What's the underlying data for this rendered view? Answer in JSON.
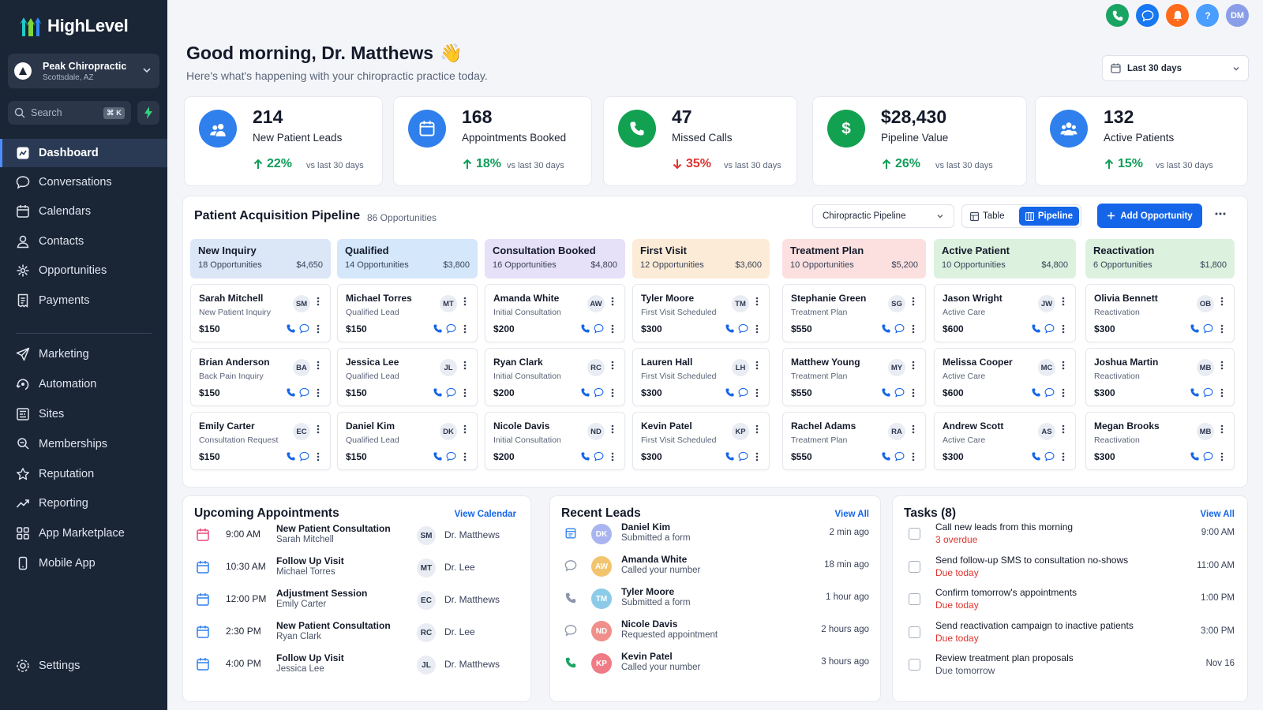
{
  "app": {
    "brand": "HighLevel"
  },
  "location": {
    "name": "Peak Chiropractic",
    "city": "Scottsdale, AZ"
  },
  "search": {
    "placeholder": "Search",
    "shortcut": "⌘ K"
  },
  "nav": [
    {
      "label": "Dashboard",
      "icon": "dashboard-icon",
      "active": true
    },
    {
      "label": "Conversations",
      "icon": "chat-icon"
    },
    {
      "label": "Calendars",
      "icon": "calendar-icon"
    },
    {
      "label": "Contacts",
      "icon": "person-icon"
    },
    {
      "label": "Opportunities",
      "icon": "opportunities-icon"
    },
    {
      "label": "Payments",
      "icon": "receipt-icon"
    },
    {
      "label": "Marketing",
      "icon": "send-icon"
    },
    {
      "label": "Automation",
      "icon": "automation-icon"
    },
    {
      "label": "Sites",
      "icon": "sites-icon"
    },
    {
      "label": "Memberships",
      "icon": "membership-icon"
    },
    {
      "label": "Reputation",
      "icon": "star-icon"
    },
    {
      "label": "Reporting",
      "icon": "trend-icon"
    },
    {
      "label": "App Marketplace",
      "icon": "grid-icon"
    },
    {
      "label": "Mobile App",
      "icon": "mobile-icon"
    }
  ],
  "settings": {
    "label": "Settings"
  },
  "top_icons": [
    {
      "name": "phone-icon",
      "color": "#19a463"
    },
    {
      "name": "chat-icon",
      "color": "#1877f2"
    },
    {
      "name": "bell-icon",
      "color": "#ff6b1a"
    },
    {
      "name": "help-icon",
      "color": "#4a9eff"
    }
  ],
  "user": {
    "initials": "DM"
  },
  "greeting": {
    "title": "Good morning, Dr. Matthews",
    "emoji": "👋",
    "subtitle": "Here's what's happening with your chiropractic practice today."
  },
  "date_range": {
    "label": "Last 30 days"
  },
  "stats": [
    {
      "value": "214",
      "label": "New Patient Leads",
      "change": "22%",
      "direction": "up",
      "compare": "vs last 30 days",
      "icon": "users-icon",
      "color": "#2f80ed"
    },
    {
      "value": "168",
      "label": "Appointments Booked",
      "change": "18%",
      "direction": "up",
      "compare": "vs last 30 days",
      "icon": "calendar-icon",
      "color": "#2f80ed"
    },
    {
      "value": "47",
      "label": "Missed Calls",
      "change": "35%",
      "direction": "down",
      "compare": "vs last 30 days",
      "icon": "phone-icon",
      "color": "#12a150"
    },
    {
      "value": "$28,430",
      "label": "Pipeline Value",
      "change": "26%",
      "direction": "up",
      "compare": "vs last 30 days",
      "icon": "dollar-icon",
      "color": "#12a150"
    },
    {
      "value": "132",
      "label": "Active Patients",
      "change": "15%",
      "direction": "up",
      "compare": "vs last 30 days",
      "icon": "group-icon",
      "color": "#2f80ed"
    }
  ],
  "pipeline": {
    "title": "Patient Acquisition Pipeline",
    "count": "86 Opportunities",
    "selector": "Chiropractic Pipeline",
    "view_table": "Table",
    "view_pipeline": "Pipeline",
    "add_button": "Add Opportunity",
    "columns": [
      {
        "name": "New Inquiry",
        "count": "18 Opportunities",
        "value": "$4,650",
        "color": "#dbe6f7",
        "cards": [
          {
            "name": "Sarah Mitchell",
            "stage": "New Patient Inquiry",
            "price": "$150",
            "initials": "SM"
          },
          {
            "name": "Brian Anderson",
            "stage": "Back Pain Inquiry",
            "price": "$150",
            "initials": "BA"
          },
          {
            "name": "Emily Carter",
            "stage": "Consultation Request",
            "price": "$150",
            "initials": "EC"
          }
        ]
      },
      {
        "name": "Qualified",
        "count": "14 Opportunities",
        "value": "$3,800",
        "color": "#d4e7fb",
        "cards": [
          {
            "name": "Michael Torres",
            "stage": "Qualified Lead",
            "price": "$150",
            "initials": "MT"
          },
          {
            "name": "Jessica Lee",
            "stage": "Qualified Lead",
            "price": "$150",
            "initials": "JL"
          },
          {
            "name": "Daniel Kim",
            "stage": "Qualified Lead",
            "price": "$150",
            "initials": "DK"
          }
        ]
      },
      {
        "name": "Consultation Booked",
        "count": "16 Opportunities",
        "value": "$4,800",
        "color": "#e6e0f8",
        "cards": [
          {
            "name": "Amanda White",
            "stage": "Initial Consultation",
            "price": "$200",
            "initials": "AW"
          },
          {
            "name": "Ryan Clark",
            "stage": "Initial Consultation",
            "price": "$200",
            "initials": "RC"
          },
          {
            "name": "Nicole Davis",
            "stage": "Initial Consultation",
            "price": "$200",
            "initials": "ND"
          }
        ]
      },
      {
        "name": "First Visit",
        "count": "12 Opportunities",
        "value": "$3,600",
        "color": "#fcebd6",
        "cards": [
          {
            "name": "Tyler Moore",
            "stage": "First Visit Scheduled",
            "price": "$300",
            "initials": "TM"
          },
          {
            "name": "Lauren Hall",
            "stage": "First Visit Scheduled",
            "price": "$300",
            "initials": "LH"
          },
          {
            "name": "Kevin Patel",
            "stage": "First Visit Scheduled",
            "price": "$300",
            "initials": "KP"
          }
        ]
      },
      {
        "name": "Treatment Plan",
        "count": "10 Opportunities",
        "value": "$5,200",
        "color": "#fbe0df",
        "cards": [
          {
            "name": "Stephanie Green",
            "stage": "Treatment Plan",
            "price": "$550",
            "initials": "SG"
          },
          {
            "name": "Matthew Young",
            "stage": "Treatment Plan",
            "price": "$550",
            "initials": "MY"
          },
          {
            "name": "Rachel Adams",
            "stage": "Treatment Plan",
            "price": "$550",
            "initials": "RA"
          }
        ]
      },
      {
        "name": "Active Patient",
        "count": "10 Opportunities",
        "value": "$4,800",
        "color": "#dcf1de",
        "cards": [
          {
            "name": "Jason Wright",
            "stage": "Active Care",
            "price": "$600",
            "initials": "JW"
          },
          {
            "name": "Melissa Cooper",
            "stage": "Active Care",
            "price": "$600",
            "initials": "MC"
          },
          {
            "name": "Andrew Scott",
            "stage": "Active Care",
            "price": "$300",
            "initials": "AS"
          }
        ]
      },
      {
        "name": "Reactivation",
        "count": "6 Opportunities",
        "value": "$1,800",
        "color": "#dcf1de",
        "cards": [
          {
            "name": "Olivia Bennett",
            "stage": "Reactivation",
            "price": "$300",
            "initials": "OB"
          },
          {
            "name": "Joshua Martin",
            "stage": "Reactivation",
            "price": "$300",
            "initials": "MB"
          },
          {
            "name": "Megan Brooks",
            "stage": "Reactivation",
            "price": "$300",
            "initials": "MB"
          }
        ]
      }
    ]
  },
  "appointments": {
    "title": "Upcoming Appointments",
    "link": "View Calendar",
    "items": [
      {
        "time": "9:00 AM",
        "title": "New Patient Consultation",
        "patient": "Sarah Mitchell",
        "initials": "SM",
        "doctor": "Dr. Matthews",
        "icon_color": "#e84a7a"
      },
      {
        "time": "10:30 AM",
        "title": "Follow Up Visit",
        "patient": "Michael Torres",
        "initials": "MT",
        "doctor": "Dr. Lee",
        "icon_color": "#2f80ed"
      },
      {
        "time": "12:00 PM",
        "title": "Adjustment Session",
        "patient": "Emily Carter",
        "initials": "EC",
        "doctor": "Dr. Matthews",
        "icon_color": "#2f80ed"
      },
      {
        "time": "2:30 PM",
        "title": "New Patient Consultation",
        "patient": "Ryan Clark",
        "initials": "RC",
        "doctor": "Dr. Lee",
        "icon_color": "#2f80ed"
      },
      {
        "time": "4:00 PM",
        "title": "Follow Up Visit",
        "patient": "Jessica Lee",
        "initials": "JL",
        "doctor": "Dr. Matthews",
        "icon_color": "#2f80ed"
      }
    ]
  },
  "leads": {
    "title": "Recent Leads",
    "link": "View All",
    "items": [
      {
        "name": "Daniel Kim",
        "action": "Submitted a form",
        "time": "2 min ago",
        "initials": "DK",
        "avatar_color": "#a9b4f0",
        "icon": "form-icon"
      },
      {
        "name": "Amanda White",
        "action": "Called your number",
        "time": "18 min ago",
        "initials": "AW",
        "avatar_color": "#f2c46d",
        "icon": "chat-icon"
      },
      {
        "name": "Tyler Moore",
        "action": "Submitted a form",
        "time": "1 hour ago",
        "initials": "TM",
        "avatar_color": "#8ccbe8",
        "icon": "phone-icon"
      },
      {
        "name": "Nicole Davis",
        "action": "Requested appointment",
        "time": "2 hours ago",
        "initials": "ND",
        "avatar_color": "#f08f8a",
        "icon": "chat-icon"
      },
      {
        "name": "Kevin Patel",
        "action": "Called your number",
        "time": "3 hours ago",
        "initials": "KP",
        "avatar_color": "#f07a86",
        "icon": "phone-icon"
      }
    ]
  },
  "tasks": {
    "title": "Tasks (8)",
    "link": "View All",
    "items": [
      {
        "text": "Call new leads from this morning",
        "due": "3 overdue",
        "due_color": "red",
        "time": "9:00 AM"
      },
      {
        "text": "Send follow-up SMS to consultation no-shows",
        "due": "Due today",
        "due_color": "red",
        "time": "11:00 AM"
      },
      {
        "text": "Confirm tomorrow's appointments",
        "due": "Due today",
        "due_color": "red",
        "time": "1:00 PM"
      },
      {
        "text": "Send reactivation campaign to inactive patients",
        "due": "Due today",
        "due_color": "red",
        "time": "3:00 PM"
      },
      {
        "text": "Review treatment plan proposals",
        "due": "Due tomorrow",
        "due_color": "gray",
        "time": "Nov 16"
      }
    ]
  }
}
